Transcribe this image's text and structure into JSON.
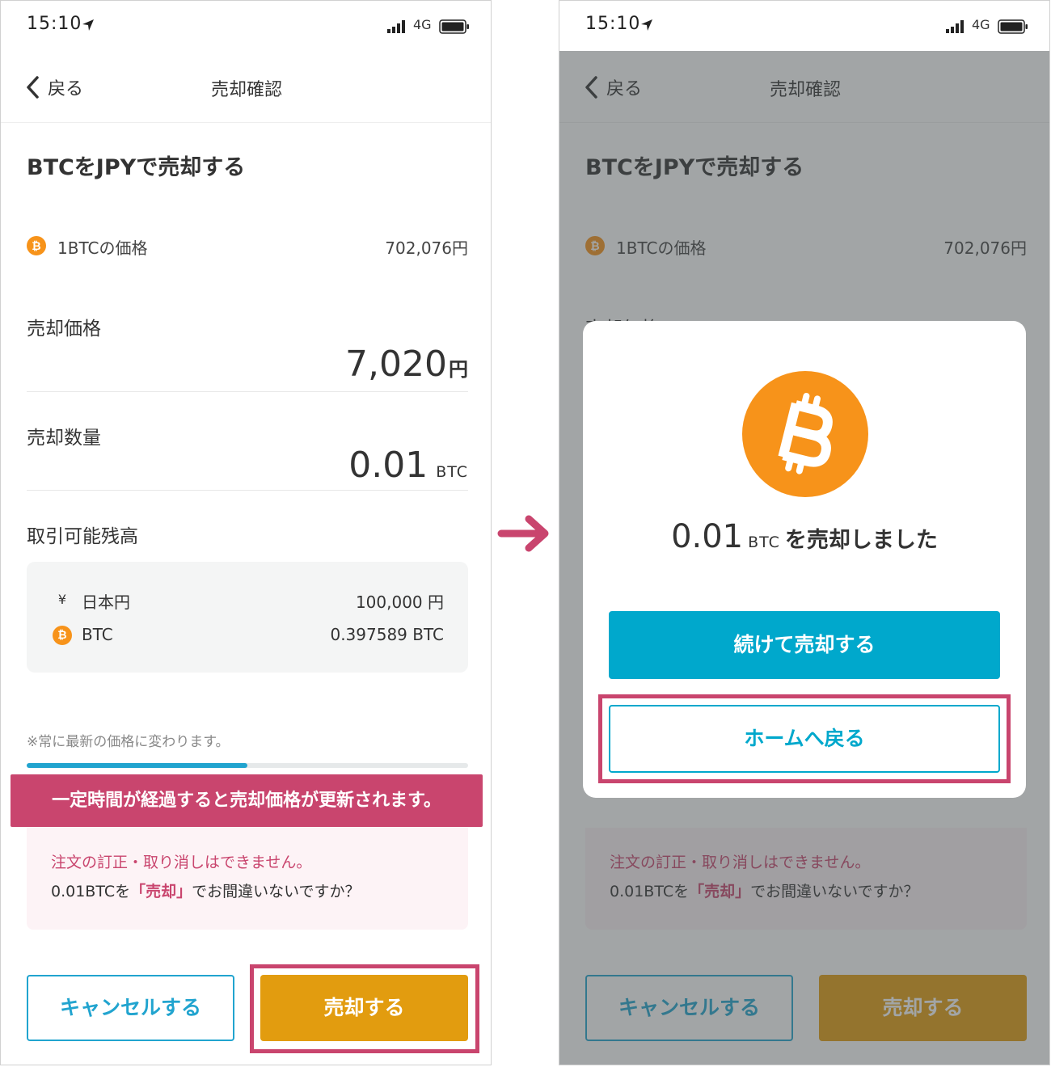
{
  "status": {
    "time": "15:10",
    "network": "4G"
  },
  "nav": {
    "back_label": "戻る",
    "title": "売却確認"
  },
  "heading": "BTCをJPYで売却する",
  "rate": {
    "coin_symbol": "₿",
    "label": "1BTCの価格",
    "value": "702,076円"
  },
  "sell_price": {
    "label": "売却価格",
    "amount": "7,020",
    "unit": "円"
  },
  "sell_quantity": {
    "label": "売却数量",
    "amount": "0.01",
    "unit": "BTC"
  },
  "balance": {
    "label": "取引可能残高",
    "rows": [
      {
        "icon": "¥",
        "name": "日本円",
        "value": "100,000 円"
      },
      {
        "icon": "₿",
        "name": "BTC",
        "value": "0.397589 BTC"
      }
    ]
  },
  "notice": "※常に最新の価格に変わります。",
  "progress_fraction": 0.5,
  "tooltip": "一定時間が経過すると売却価格が更新されます。",
  "warning": {
    "title": "注文の訂正・取り消しはできません。",
    "line_prefix": "0.01BTCを",
    "line_highlight": "「売却」",
    "line_suffix": "でお間違いないですか？"
  },
  "buttons": {
    "cancel": "キャンセルする",
    "sell": "売却する"
  },
  "modal": {
    "amount": "0.01",
    "unit": "BTC",
    "suffix": "を売却しました",
    "continue_label": "続けて売却する",
    "home_label": "ホームへ戻る"
  },
  "colors": {
    "accent_blue": "#00a8cc",
    "sell_orange": "#e29c0f",
    "bitcoin_orange": "#f7931a",
    "highlight_pink": "#c9456e"
  }
}
